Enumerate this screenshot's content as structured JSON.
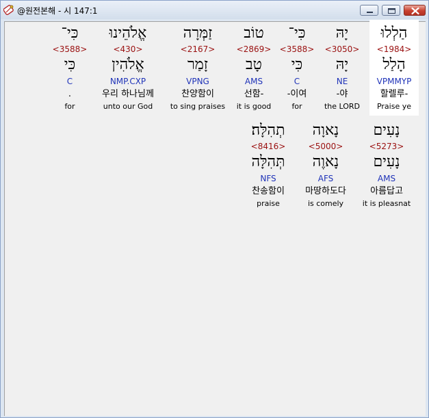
{
  "window": {
    "title": "@원전본해 - 시 147:1",
    "app_icon": "scroll-app-icon",
    "buttons": {
      "minimize_icon": "minimize-icon",
      "maximize_icon": "maximize-icon",
      "close_icon": "close-icon"
    }
  },
  "rows": [
    {
      "words": [
        {
          "hebrew": "כִּי־",
          "strong": "<3588>",
          "lemma": "כִּי",
          "morph": "C",
          "korean": ".",
          "english": "for"
        },
        {
          "hebrew": "אֱלֹהֵינוּ",
          "strong": "<430>",
          "lemma": "אֱלֹהִין",
          "morph": "NMP.CXP",
          "korean": "우리 하나님께",
          "english": "unto our God"
        },
        {
          "hebrew": "זַמְּרָה",
          "strong": "<2167>",
          "lemma": "זָמַר",
          "morph": "VPNG",
          "korean": "찬양함이",
          "english": "to sing praises"
        },
        {
          "hebrew": "טוֹב",
          "strong": "<2869>",
          "lemma": "טָב",
          "morph": "AMS",
          "korean": "선함-",
          "english": "it is good"
        },
        {
          "hebrew": "כִּי־",
          "strong": "<3588>",
          "lemma": "כִּי",
          "morph": "C",
          "korean": "-이여",
          "english": "for"
        },
        {
          "hebrew": "יָהּ",
          "strong": "<3050>",
          "lemma": "יָהּ",
          "morph": "NE",
          "korean": "-야",
          "english": "the LORD"
        },
        {
          "hebrew": "הַלְלוּ",
          "strong": "<1984>",
          "lemma": "הָלַל",
          "morph": "VPMMYP",
          "korean": "할렐루-",
          "english": "Praise ye"
        }
      ]
    },
    {
      "words": [
        {
          "hebrew": "תְהִלָּה׃",
          "strong": "<8416>",
          "lemma": "תְּהִלָּה",
          "morph": "NFS",
          "korean": "찬송함이",
          "english": "praise"
        },
        {
          "hebrew": "נָאוָה",
          "strong": "<5000>",
          "lemma": "נָאוֶה",
          "morph": "AFS",
          "korean": "마땅하도다",
          "english": "is comely"
        },
        {
          "hebrew": "נָעִים",
          "strong": "<5273>",
          "lemma": "נָעִים",
          "morph": "AMS",
          "korean": "아름답고",
          "english": "it is pleasnat"
        }
      ]
    }
  ]
}
